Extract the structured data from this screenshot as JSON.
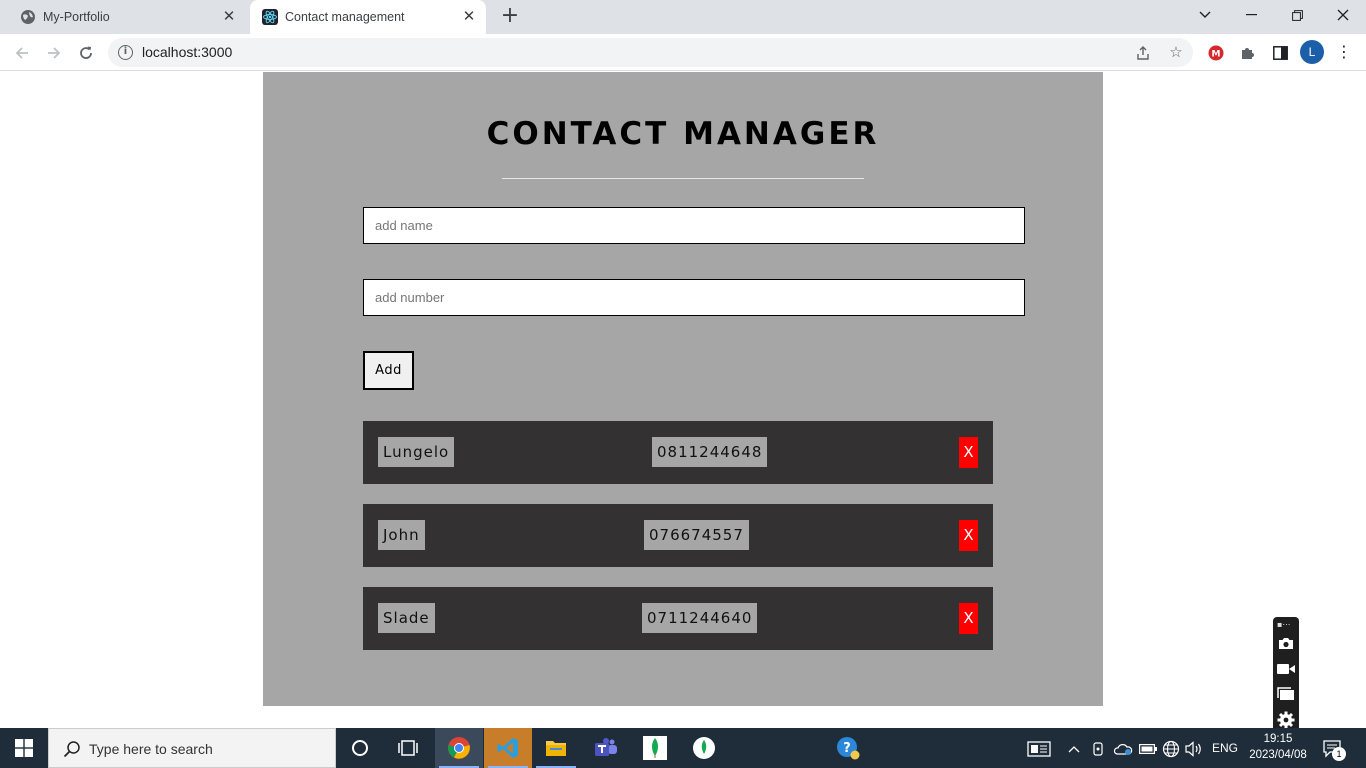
{
  "browser": {
    "tabs": [
      {
        "title": "My-Portfolio",
        "icon": "globe-icon"
      },
      {
        "title": "Contact management",
        "icon": "react-icon",
        "active": true
      }
    ],
    "url": "localhost:3000",
    "profile_initial": "L",
    "accent": "#1a73e8"
  },
  "app": {
    "title": "CONTACT MANAGER",
    "name_placeholder": "add name",
    "number_placeholder": "add number",
    "add_label": "Add",
    "delete_label": "X",
    "contacts": [
      {
        "name": "Lungelo",
        "number": "0811244648"
      },
      {
        "name": "John",
        "number": "076674557"
      },
      {
        "name": "Slade",
        "number": "0711244640"
      }
    ],
    "colors": {
      "panel": "#a6a6a6",
      "row": "#333132",
      "delete": "#ff0000"
    }
  },
  "taskbar": {
    "search_placeholder": "Type here to search",
    "language": "ENG",
    "time": "19:15",
    "date": "2023/04/08",
    "notification_count": "1"
  }
}
